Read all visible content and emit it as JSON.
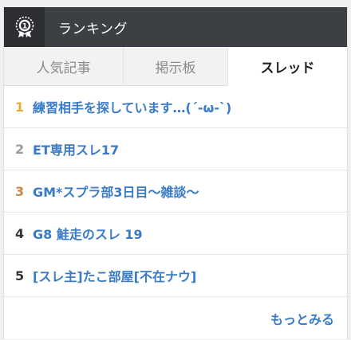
{
  "header": {
    "title": "ランキング",
    "icon": "award-medal-icon"
  },
  "tabs": [
    {
      "label": "人気記事",
      "active": false
    },
    {
      "label": "掲示板",
      "active": false
    },
    {
      "label": "スレッド",
      "active": true
    }
  ],
  "items": [
    {
      "rank": "1",
      "title": "練習相手を探しています…(´-ω-`)",
      "rank_color": "#e8a838"
    },
    {
      "rank": "2",
      "title": "ET専用スレ17",
      "rank_color": "#9a9a9a"
    },
    {
      "rank": "3",
      "title": "GM*スプラ部3日目〜雑談〜",
      "rank_color": "#c8884a"
    },
    {
      "rank": "4",
      "title": "G8 鮭走のスレ 19",
      "rank_color": "#333333"
    },
    {
      "rank": "5",
      "title": "[スレ主]たこ部屋[不在ナウ]",
      "rank_color": "#333333"
    }
  ],
  "more_label": "もっとみる",
  "colors": {
    "header_bg": "#3c3f44",
    "link": "#3a7bc8"
  }
}
